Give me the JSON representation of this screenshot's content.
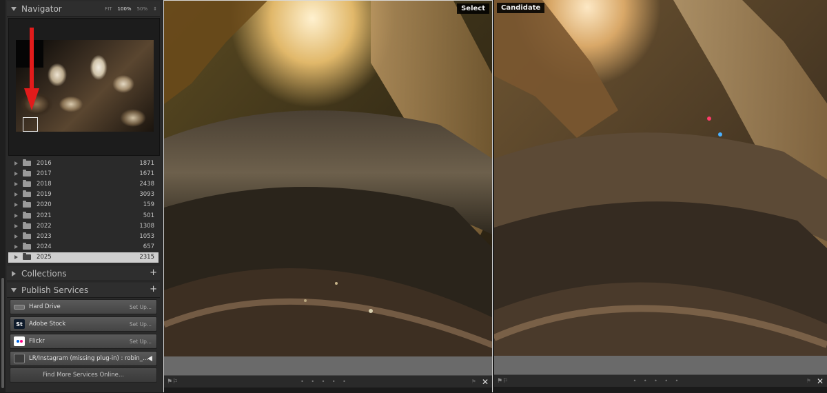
{
  "navigator": {
    "title": "Navigator",
    "zoom_options": [
      "FIT",
      "100%",
      "50%"
    ],
    "selected_zoom": "100%"
  },
  "folders": [
    {
      "label": "2016",
      "count": "1871"
    },
    {
      "label": "2017",
      "count": "1671"
    },
    {
      "label": "2018",
      "count": "2438"
    },
    {
      "label": "2019",
      "count": "3093"
    },
    {
      "label": "2020",
      "count": "159"
    },
    {
      "label": "2021",
      "count": "501"
    },
    {
      "label": "2022",
      "count": "1308"
    },
    {
      "label": "2023",
      "count": "1053"
    },
    {
      "label": "2024",
      "count": "657"
    },
    {
      "label": "2025",
      "count": "2315",
      "selected": true
    }
  ],
  "collections": {
    "title": "Collections",
    "add": "+"
  },
  "publish": {
    "title": "Publish Services",
    "add": "+",
    "services": [
      {
        "name": "Hard Drive",
        "action": "Set Up...",
        "icon": "hard-drive-icon"
      },
      {
        "name": "Adobe Stock",
        "action": "Set Up...",
        "icon": "adobe-stock-icon",
        "icon_text": "St"
      },
      {
        "name": "Flickr",
        "action": "Set Up...",
        "icon": "flickr-icon"
      },
      {
        "name": "LR/Instagram (missing plug-in)  :  robin_...",
        "icon": "instagram-plugin-icon"
      }
    ],
    "find_more": "Find More Services Online..."
  },
  "compare": {
    "select_label": "Select",
    "candidate_label": "Candidate",
    "close_glyph": "✕",
    "dots": "• • • • •"
  },
  "colors": {
    "panel_bg": "#2a2a2a",
    "selected_row": "#cfcfcf",
    "arrow_red": "#e11b1b"
  }
}
